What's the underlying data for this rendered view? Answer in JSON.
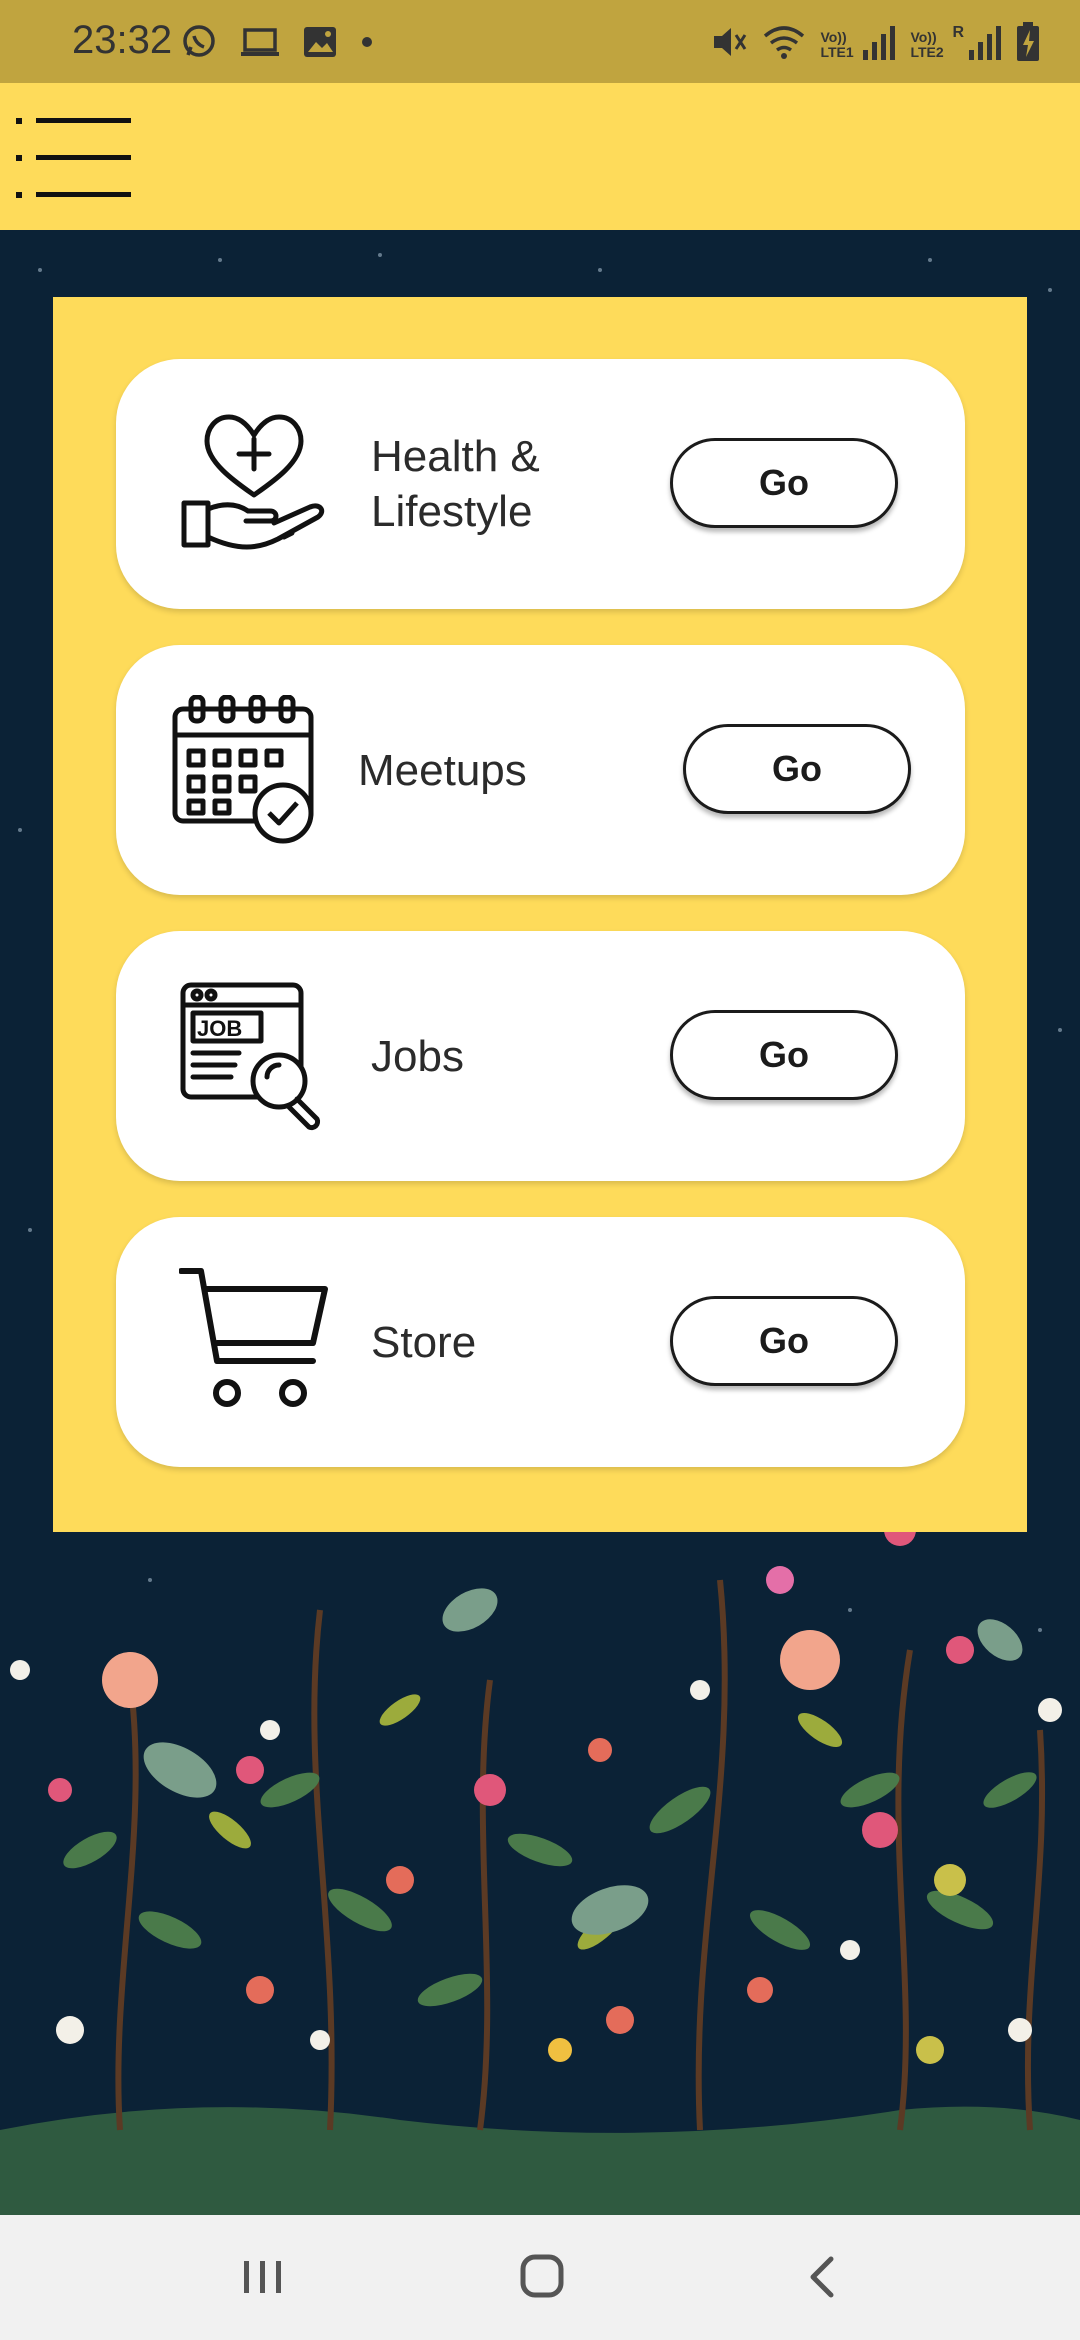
{
  "status_bar": {
    "time": "23:32",
    "left_icons": [
      "whatsapp-icon",
      "laptop-icon",
      "gallery-icon",
      "dot-icon"
    ],
    "right_icons": [
      "mute-icon",
      "wifi-icon",
      "signal-lte1-icon",
      "signal-lte2-icon",
      "battery-charging-icon"
    ],
    "lte1_label": "Vo)) LTE1",
    "lte2_label": "Vo)) LTE2",
    "roaming_label": "R"
  },
  "app_bar": {
    "menu_icon": "list-menu-icon",
    "background_color": "#fedb5a"
  },
  "cards": [
    {
      "label_line1": "Health &",
      "label_line2": "Lifestyle",
      "icon": "heart-hand-icon",
      "button": "Go"
    },
    {
      "label": "Meetups",
      "icon": "calendar-check-icon",
      "button": "Go"
    },
    {
      "label": "Jobs",
      "icon": "job-search-icon",
      "button": "Go"
    },
    {
      "label": "Store",
      "icon": "shopping-cart-icon",
      "button": "Go"
    }
  ],
  "nav_bar": {
    "items": [
      "recent-apps-icon",
      "home-icon",
      "back-icon"
    ]
  },
  "colors": {
    "accent_yellow": "#fedb5a",
    "status_bar": "#c0a43f",
    "background_navy": "#0b2236"
  }
}
